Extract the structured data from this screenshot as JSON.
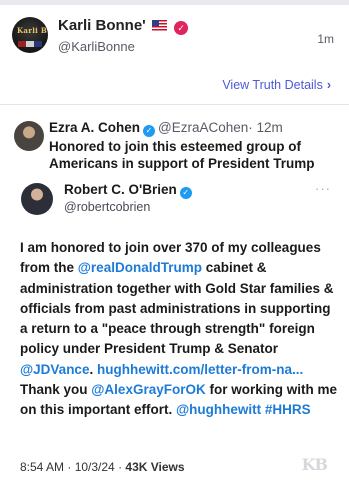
{
  "header": {
    "name": "Karli Bonne'",
    "handle": "@KarliBonne",
    "time": "1m",
    "view_details": "View Truth Details",
    "verified_color": "#e0245e"
  },
  "quote": {
    "author_name": "Ezra A. Cohen",
    "author_handle": "@EzraACohen",
    "time": "· 12m",
    "text_line1": "Honored to join this esteemed group of",
    "text_line2": "Americans in support of President Trump",
    "inner": {
      "name": "Robert C. O'Brien",
      "handle": "@robertcobrien",
      "more": "···",
      "segments": [
        {
          "t": "I am honored to join over 370 of my colleagues from the ",
          "link": false
        },
        {
          "t": "@realDonaldTrump",
          "link": true
        },
        {
          "t": " cabinet & administration together with Gold Star families & officials from past administrations in supporting a return to a \"peace through strength\" foreign policy under President Trump & Senator ",
          "link": false
        },
        {
          "t": "@JDVance",
          "link": true
        },
        {
          "t": ".  ",
          "link": false
        },
        {
          "t": "hughhewitt.com/letter-from-na...",
          "link": true
        },
        {
          "t": " Thank you ",
          "link": false
        },
        {
          "t": "@AlexGrayForOK",
          "link": true
        },
        {
          "t": " for working with me on this important effort. ",
          "link": false
        },
        {
          "t": "@hughhewitt",
          "link": true
        },
        {
          "t": " ",
          "link": false
        },
        {
          "t": "#HHRS",
          "link": true
        }
      ],
      "meta_time": "8:54 AM · 10/3/24 · ",
      "meta_views": "43K Views"
    }
  },
  "watermark": "KB",
  "colors": {
    "link": "#1d7bd8",
    "accent": "#4d5bd6",
    "blue_check": "#1d9bf0"
  }
}
